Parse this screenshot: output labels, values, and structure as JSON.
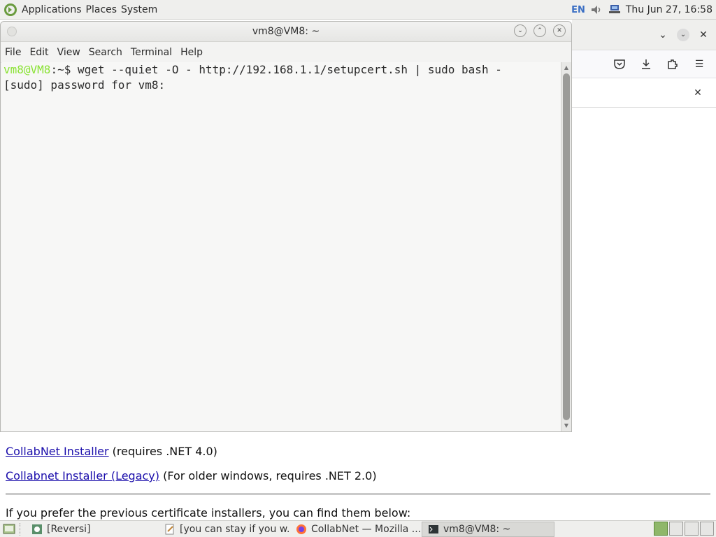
{
  "top_panel": {
    "menus": [
      "Applications",
      "Places",
      "System"
    ],
    "keyboard_layout": "EN",
    "clock": "Thu Jun 27, 16:58"
  },
  "terminal": {
    "title": "vm8@VM8: ~",
    "menus": [
      "File",
      "Edit",
      "View",
      "Search",
      "Terminal",
      "Help"
    ],
    "prompt_user": "vm8@VM8",
    "prompt_path": ":~$ ",
    "command": "wget --quiet -O - http://192.168.1.1/setupcert.sh | sudo bash -",
    "output_line": "[sudo] password for vm8:"
  },
  "browser_page": {
    "link1": "CollabNet Installer",
    "link1_note": " (requires .NET 4.0)",
    "link2": "Collabnet Installer (Legacy)",
    "link2_note": " (For older windows, requires .NET 2.0)",
    "prev_text": "If you prefer the previous certificate installers, you can find them below:"
  },
  "taskbar": {
    "tasks": [
      {
        "label": "[Reversi]",
        "icon": "reversi-icon"
      },
      {
        "label": "[you can stay if you w...",
        "icon": "text-editor-icon"
      },
      {
        "label": "CollabNet — Mozilla ...",
        "icon": "firefox-icon"
      },
      {
        "label": "vm8@VM8: ~",
        "icon": "terminal-icon"
      }
    ]
  },
  "colors": {
    "prompt_green": "#8ae234",
    "link_blue": "#1a0dab",
    "workspace_active": "#8fb76a"
  }
}
